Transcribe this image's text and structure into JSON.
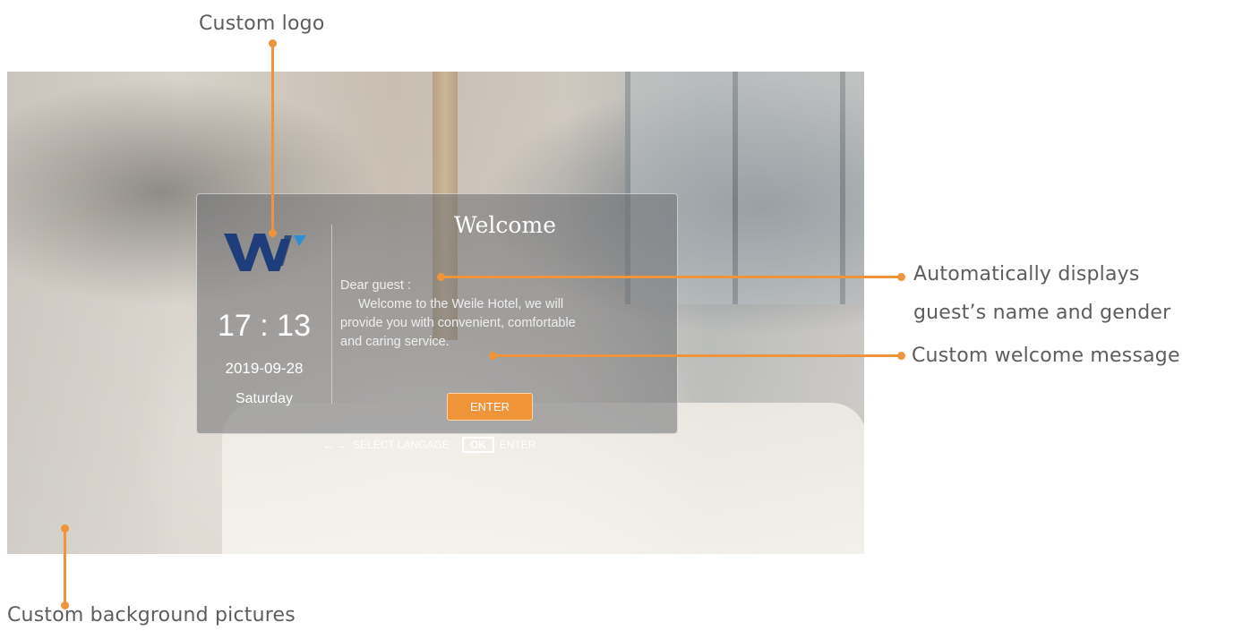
{
  "annotations": {
    "logo": "Custom logo",
    "guest_line1": "Automatically displays",
    "guest_line2": "guest’s name and gender",
    "message": "Custom welcome message",
    "background": "Custom background pictures"
  },
  "panel": {
    "time": "17 : 13",
    "date": "2019-09-28",
    "day": "Saturday",
    "title": "Welcome",
    "greeting": "Dear guest :",
    "message_line1": "Welcome to the Weile Hotel, we will",
    "message_line2": "provide you with convenient, comfortable",
    "message_line3": "and caring service.",
    "enter_label": "ENTER"
  },
  "hint": {
    "arrows": "←→",
    "select": "SELECT LANGAGE",
    "ok": "OK",
    "enter": "ENTER"
  },
  "colors": {
    "accent": "#f0943a",
    "logo_navy": "#1f3d7a",
    "logo_blue": "#2c8fd6"
  }
}
